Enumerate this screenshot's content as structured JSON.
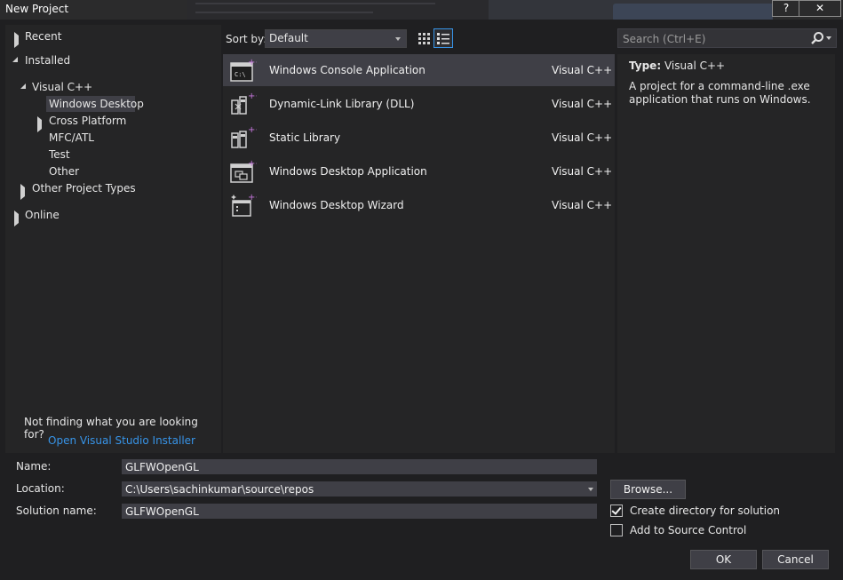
{
  "window": {
    "title": "New Project",
    "help_label": "?",
    "close_label": "✕"
  },
  "tree": {
    "recent": "Recent",
    "installed": "Installed",
    "visual_cpp": "Visual C++",
    "windows_desktop": "Windows Desktop",
    "cross_platform": "Cross Platform",
    "mfc_atl": "MFC/ATL",
    "test": "Test",
    "other": "Other",
    "other_project_types": "Other Project Types",
    "online": "Online"
  },
  "help": {
    "not_finding": "Not finding what you are looking for?",
    "installer_link": "Open Visual Studio Installer"
  },
  "sort": {
    "label": "Sort by:",
    "value": "Default"
  },
  "templates": [
    {
      "name": "Windows Console Application",
      "lang": "Visual C++",
      "icon": "console-app-icon"
    },
    {
      "name": "Dynamic-Link Library (DLL)",
      "lang": "Visual C++",
      "icon": "dll-icon"
    },
    {
      "name": "Static Library",
      "lang": "Visual C++",
      "icon": "static-library-icon"
    },
    {
      "name": "Windows Desktop Application",
      "lang": "Visual C++",
      "icon": "desktop-app-icon"
    },
    {
      "name": "Windows Desktop Wizard",
      "lang": "Visual C++",
      "icon": "desktop-wizard-icon"
    }
  ],
  "search": {
    "placeholder": "Search (Ctrl+E)",
    "value": ""
  },
  "details": {
    "type_key": "Type:",
    "type_value": "Visual C++",
    "description": "A project for a command-line .exe application that runs on Windows."
  },
  "form": {
    "name_label": "Name:",
    "name_value": "GLFWOpenGL",
    "location_label": "Location:",
    "location_value": "C:\\Users\\sachinkumar\\source\\repos",
    "solution_label": "Solution name:",
    "solution_value": "GLFWOpenGL",
    "browse_label": "Browse...",
    "create_dir_label": "Create directory for solution",
    "create_dir_checked": true,
    "source_control_label": "Add to Source Control",
    "source_control_checked": false,
    "ok_label": "OK",
    "cancel_label": "Cancel"
  },
  "colors": {
    "accent": "#3794e8",
    "selection": "#3f3f46",
    "panel": "#252526",
    "background": "#1f1f21"
  }
}
